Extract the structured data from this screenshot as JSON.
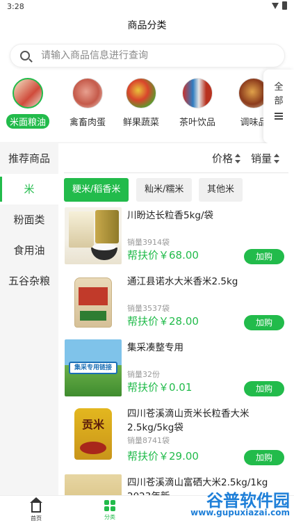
{
  "status": {
    "time": "3:28"
  },
  "header": {
    "title": "商品分类"
  },
  "search": {
    "placeholder": "请输入商品信息进行查询"
  },
  "categories": [
    {
      "label": "米面粮油",
      "icon": "rice-oil-products",
      "active": true
    },
    {
      "label": "禽畜肉蛋",
      "icon": "meat-eggs",
      "active": false
    },
    {
      "label": "鲜果蔬菜",
      "icon": "fruits-vegetables",
      "active": false
    },
    {
      "label": "茶叶饮品",
      "icon": "tea-drinks",
      "active": false
    },
    {
      "label": "调味品",
      "icon": "seasonings",
      "active": false
    }
  ],
  "all_button": {
    "line1": "全",
    "line2": "部"
  },
  "sidebar": {
    "items": [
      {
        "label": "推荐商品",
        "active": false
      },
      {
        "label": "米",
        "active": true
      },
      {
        "label": "粉面类",
        "active": false
      },
      {
        "label": "食用油",
        "active": false
      },
      {
        "label": "五谷杂粮",
        "active": false
      }
    ]
  },
  "sort": {
    "price_label": "价格",
    "sales_label": "销量"
  },
  "subtabs": [
    {
      "label": "粳米/稻香米",
      "active": true
    },
    {
      "label": "籼米/糯米",
      "active": false
    },
    {
      "label": "其他米",
      "active": false
    }
  ],
  "products": [
    {
      "name": "川盼达长粒香5kg/袋",
      "sales": "销量3914袋",
      "price": "帮扶价￥68.00",
      "buy": "加购"
    },
    {
      "name": "通江县诺水大米香米2.5kg",
      "sales": "销量3537袋",
      "price": "帮扶价￥28.00",
      "buy": "加购"
    },
    {
      "name": "集采凑整专用",
      "sales": "销量32份",
      "price": "帮扶价￥0.01",
      "buy": "加购",
      "img_text": "集采专用链接"
    },
    {
      "name": "四川苍溪滴山贡米长粒香大米2.5kg/5kg袋",
      "sales": "销量8741袋",
      "price": "帮扶价￥29.00",
      "buy": "加购",
      "img_text": "贡米"
    },
    {
      "name": "四川苍溪滴山富硒大米2.5kg/1kg 2023年新",
      "sales": "",
      "price": "",
      "buy": ""
    }
  ],
  "tabbar": {
    "home": "首页",
    "category": "分类"
  },
  "watermark": {
    "line1": "谷普软件园",
    "line2": "www.gupuxiazai.com"
  },
  "colors": {
    "accent": "#22bb4b",
    "price": "#22bb4b",
    "background": "#f5f5f5"
  }
}
